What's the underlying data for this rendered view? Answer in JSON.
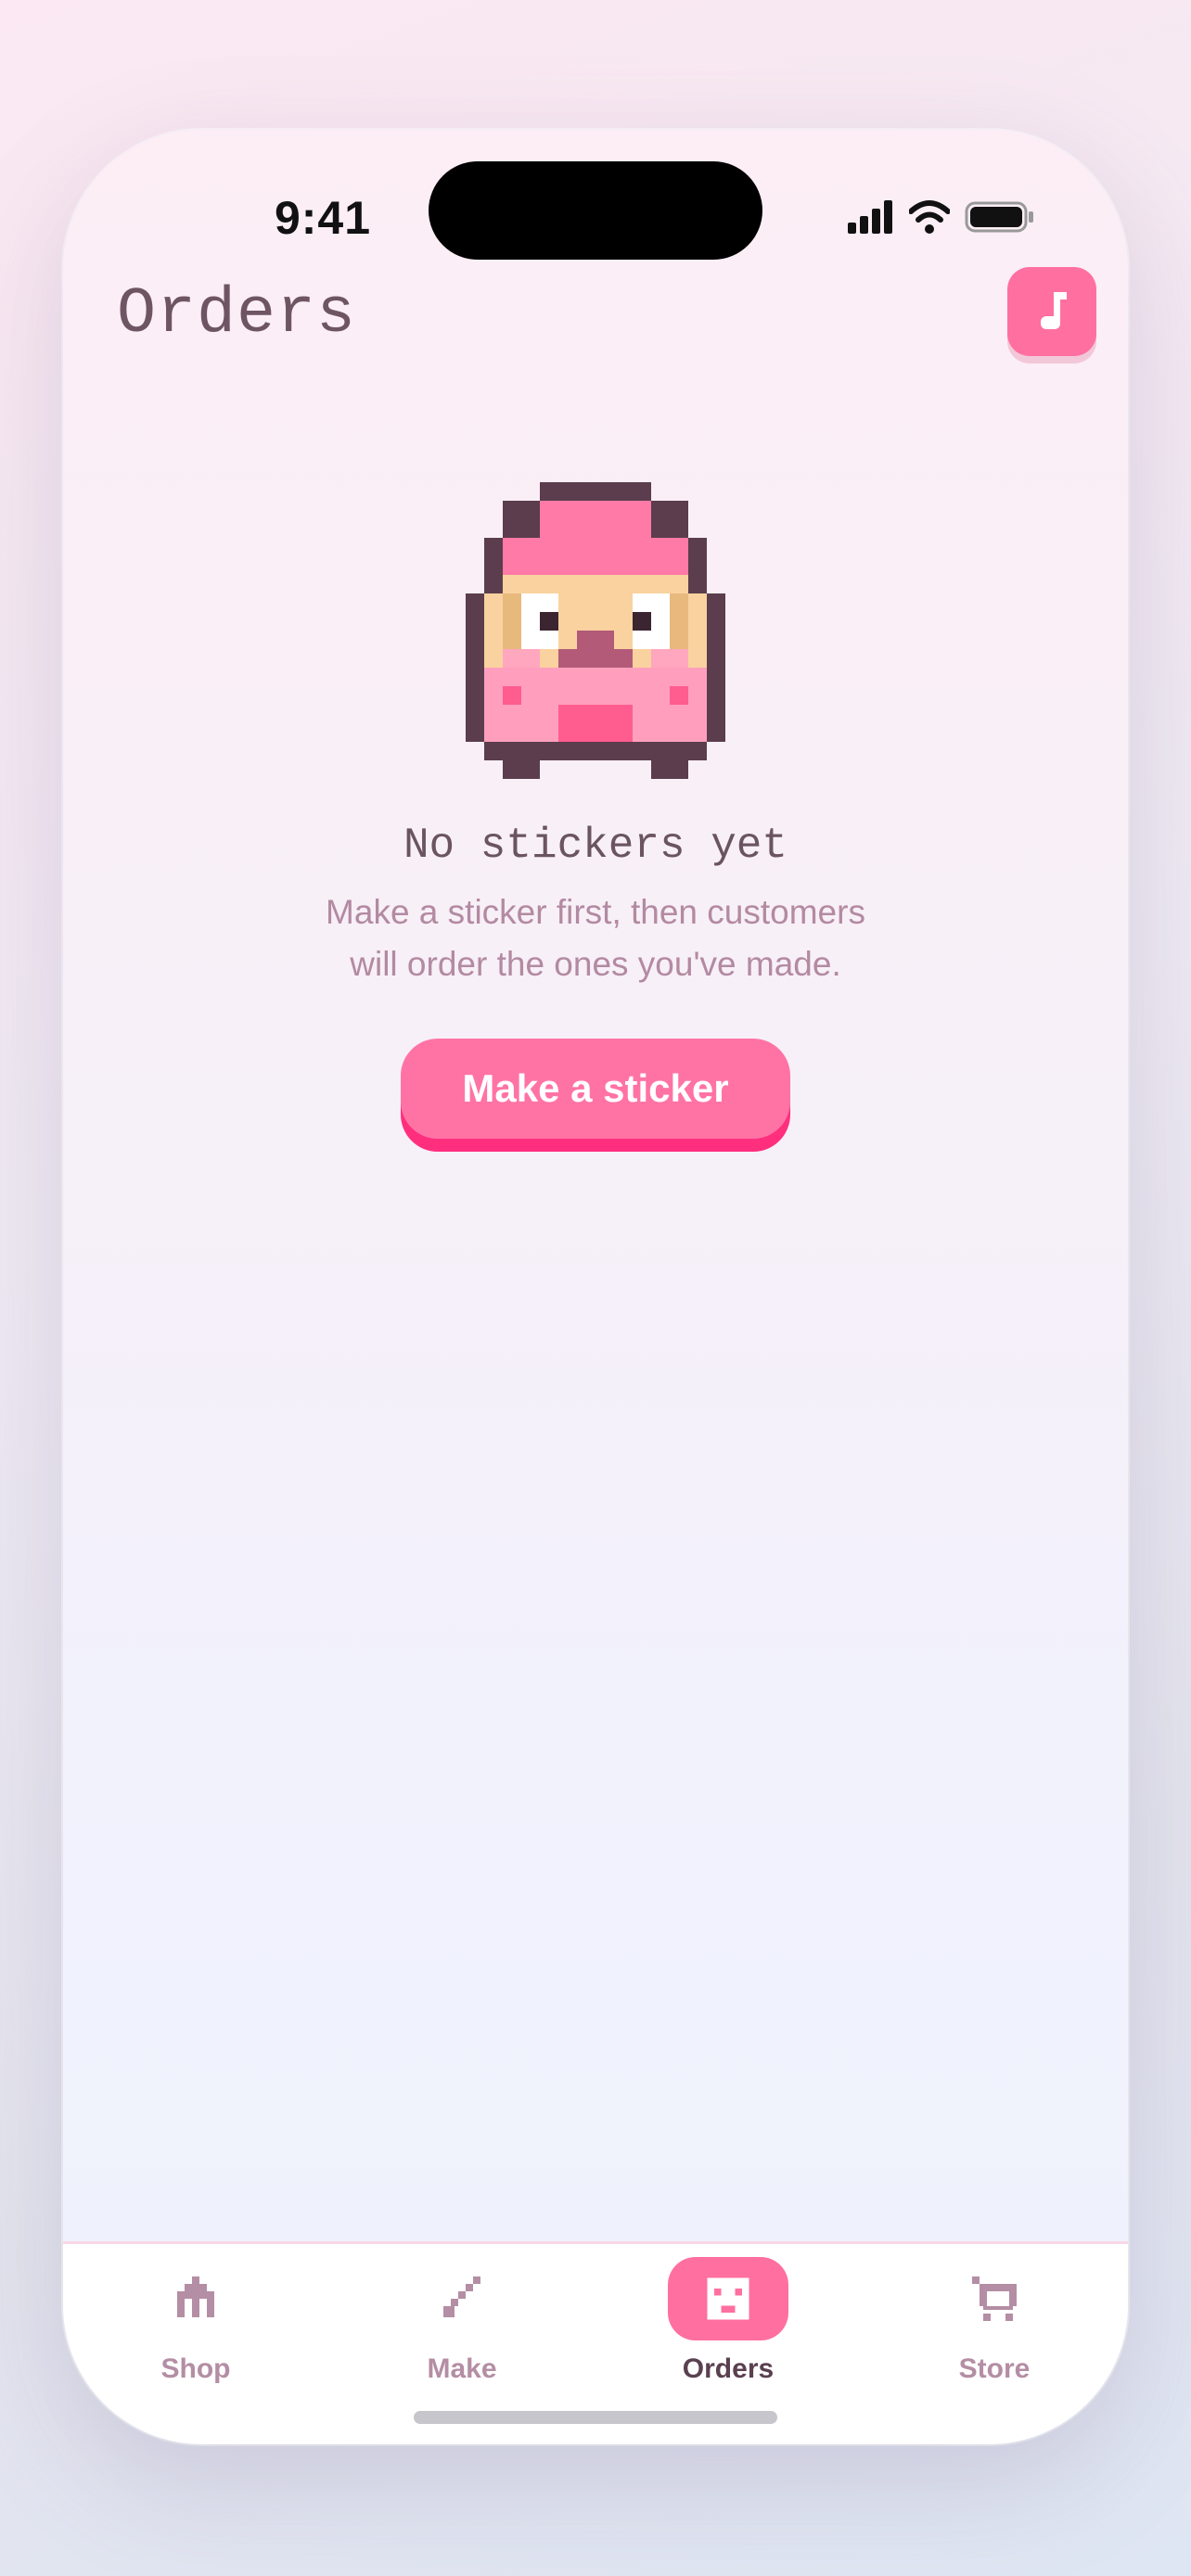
{
  "status_bar": {
    "time": "9:41"
  },
  "header": {
    "title": "Orders",
    "music_button_icon": "music-note-icon"
  },
  "empty_state": {
    "mascot_icon": "pixel-mascot-icon",
    "title": "No stickers yet",
    "description": "Make a sticker first, then customers will order the ones you've made.",
    "button_label": "Make a sticker"
  },
  "tabs": [
    {
      "label": "Shop",
      "icon": "shop-icon",
      "active": false
    },
    {
      "label": "Make",
      "icon": "pencil-icon",
      "active": false
    },
    {
      "label": "Orders",
      "icon": "orders-face-icon",
      "active": true
    },
    {
      "label": "Store",
      "icon": "store-icon",
      "active": false
    }
  ],
  "colors": {
    "accent": "#ff6fa0",
    "accent_shadow": "#ff2f7e",
    "title_text": "#6e5564",
    "muted_text": "#b38aa2",
    "tab_inactive": "#b48ea4",
    "tab_active": "#5a4050"
  }
}
